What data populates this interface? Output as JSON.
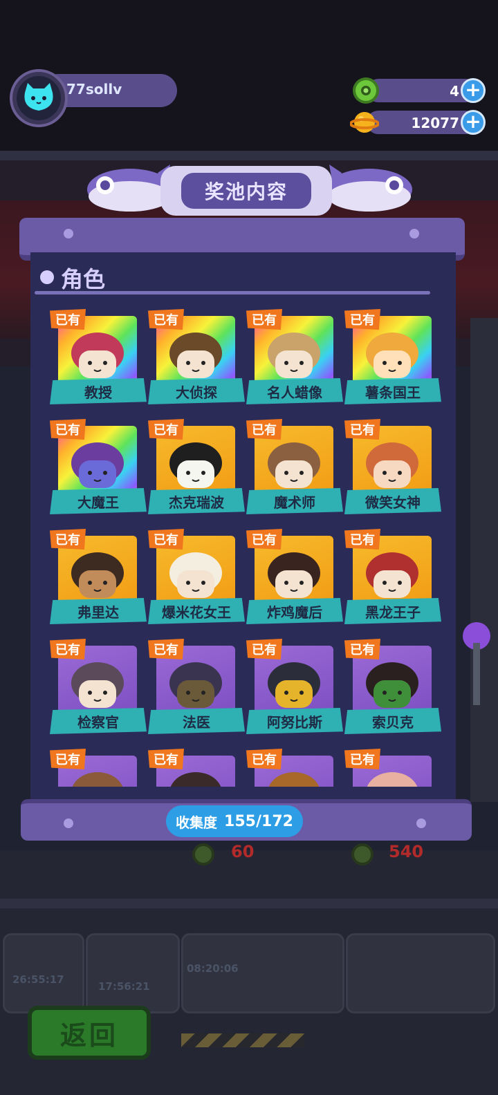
{
  "header": {
    "username": "77sollv",
    "currencies": [
      {
        "name": "gem",
        "value": "4",
        "color": "#5fbf3a"
      },
      {
        "name": "coin",
        "value": "12077",
        "color": "#f6b21c"
      }
    ]
  },
  "prize_pool": {
    "title": "奖池内容",
    "section_title": "角色",
    "owned_label": "已有",
    "characters": [
      {
        "name": "教授",
        "rarity": "rainbow"
      },
      {
        "name": "大侦探",
        "rarity": "rainbow"
      },
      {
        "name": "名人蜡像",
        "rarity": "rainbow"
      },
      {
        "name": "薯条国王",
        "rarity": "rainbow"
      },
      {
        "name": "大魔王",
        "rarity": "rainbow"
      },
      {
        "name": "杰克瑞波",
        "rarity": "gold"
      },
      {
        "name": "魔术师",
        "rarity": "gold"
      },
      {
        "name": "微笑女神",
        "rarity": "gold"
      },
      {
        "name": "弗里达",
        "rarity": "gold"
      },
      {
        "name": "爆米花女王",
        "rarity": "gold"
      },
      {
        "name": "炸鸡魔后",
        "rarity": "gold"
      },
      {
        "name": "黑龙王子",
        "rarity": "gold"
      },
      {
        "name": "检察官",
        "rarity": "purple"
      },
      {
        "name": "法医",
        "rarity": "purple"
      },
      {
        "name": "阿努比斯",
        "rarity": "purple"
      },
      {
        "name": "索贝克",
        "rarity": "purple"
      },
      {
        "name": "",
        "rarity": "purple"
      },
      {
        "name": "",
        "rarity": "purple"
      },
      {
        "name": "",
        "rarity": "purple"
      },
      {
        "name": "",
        "rarity": "purple"
      }
    ],
    "collection_label": "收集度",
    "collection_value": "155/172"
  },
  "background": {
    "prices": [
      "60",
      "540"
    ],
    "timers": [
      "26:55:17",
      "17:56:21",
      "08:20:06"
    ],
    "back_label": "返回"
  }
}
